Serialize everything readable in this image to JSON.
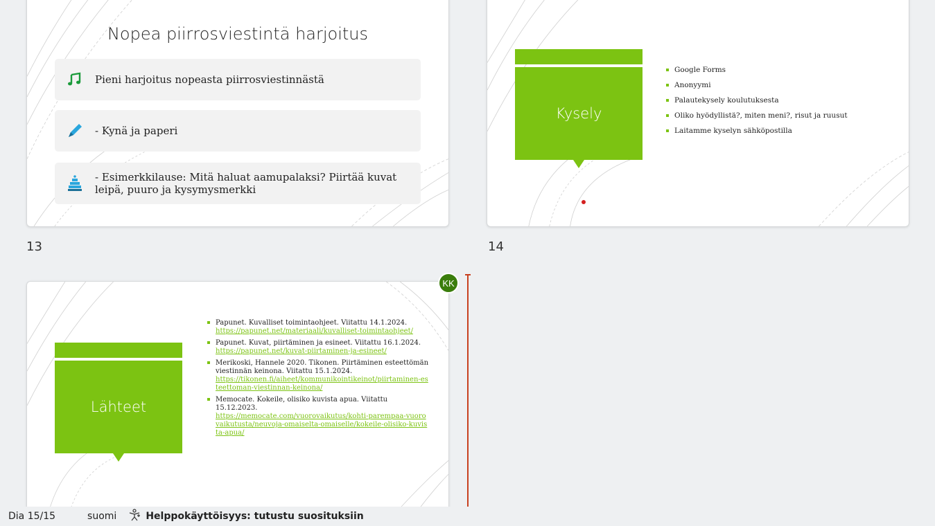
{
  "slides": {
    "s13": {
      "number": "13",
      "title": "Nopea piirrosviestintä harjoitus",
      "cards": [
        {
          "text": "Pieni harjoitus nopeasta piirrosviestinnästä",
          "icon": "music-note-icon"
        },
        {
          "text": "- Kynä ja paperi",
          "icon": "pencil-icon"
        },
        {
          "text_line1": "- Esimerkkilause: Mitä haluat aamupalaksi? Piirtää kuvat",
          "text_line2": "leipä, puuro ja kysymysmerkki",
          "icon": "cake-icon"
        }
      ]
    },
    "s14": {
      "number": "14",
      "title": "Kysely",
      "bullets": [
        "Google Forms",
        "Anonyymi",
        "Palautekysely koulutuksesta",
        "Oliko hyödyllistä?, miten meni?, risut ja ruusut",
        "Laitamme kyselyn sähköpostilla"
      ]
    },
    "s15": {
      "title": "Lähteet",
      "refs": [
        {
          "text": "Papunet. Kuvalliset toimintaohjeet. Viitattu 14.1.2024.",
          "link": "https://papunet.net/materiaali/kuvalliset-toimintaohjeet/"
        },
        {
          "text": "Papunet. Kuvat, piirtäminen ja esineet. Viitattu 16.1.2024.",
          "link": " https://papunet.net/kuvat-piirtaminen-ja-esineet/"
        },
        {
          "text": "Merikoski, Hannele 2020. Tikonen. Piirtäminen esteettömän viestinnän keinona. Viitattu 15.1.2024.",
          "link": "https://tikonen.fi/aiheet/kommunikointikeinot/piirtaminen-esteettoman-viestinnan-keinona/"
        },
        {
          "text": "Memocate. Kokeile, olisiko kuvista apua. Viitattu 15.12.2023.",
          "link": "https://memocate.com/vuorovaikutus/kohti-parempaa-vuorovaikutusta/neuvoja-omaiselta-omaiselle/kokeile-olisiko-kuvista-apua/"
        }
      ]
    }
  },
  "presence": {
    "initials": "KK",
    "color": "#3a7d0c"
  },
  "status": {
    "slide": "Dia 15/15",
    "language": "suomi",
    "accessibility": "Helppokäyttöisyys: tutustu suosituksiin"
  },
  "colors": {
    "accent": "#7cc312",
    "background": "#eef0f2"
  }
}
